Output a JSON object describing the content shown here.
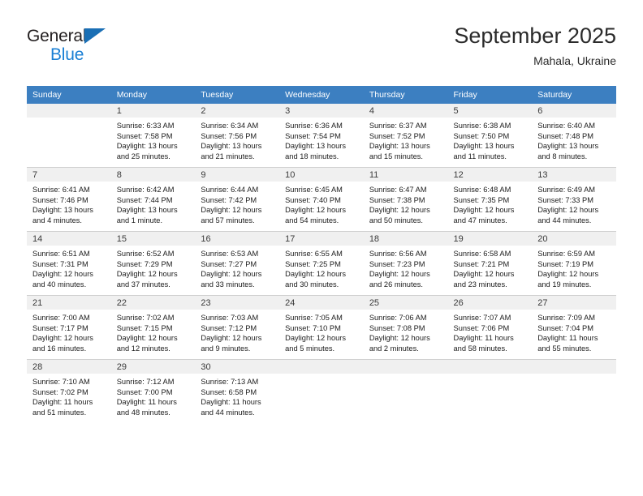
{
  "brand": {
    "line1": "General",
    "line2": "Blue",
    "triangle_color": "#1a6fb5",
    "blue_color": "#1a7fd4"
  },
  "header": {
    "title": "September 2025",
    "subtitle": "Mahala, Ukraine"
  },
  "theme": {
    "header_row_bg": "#3c7fc1",
    "daynum_bg": "#f0f0f0",
    "grid_line": "#cfcfcf"
  },
  "weekday_headers": [
    "Sunday",
    "Monday",
    "Tuesday",
    "Wednesday",
    "Thursday",
    "Friday",
    "Saturday"
  ],
  "weeks": [
    [
      {
        "day": "",
        "sunrise": "",
        "sunset": "",
        "daylight1": "",
        "daylight2": "",
        "empty": true
      },
      {
        "day": "1",
        "sunrise": "Sunrise: 6:33 AM",
        "sunset": "Sunset: 7:58 PM",
        "daylight1": "Daylight: 13 hours",
        "daylight2": "and 25 minutes.",
        "empty": false
      },
      {
        "day": "2",
        "sunrise": "Sunrise: 6:34 AM",
        "sunset": "Sunset: 7:56 PM",
        "daylight1": "Daylight: 13 hours",
        "daylight2": "and 21 minutes.",
        "empty": false
      },
      {
        "day": "3",
        "sunrise": "Sunrise: 6:36 AM",
        "sunset": "Sunset: 7:54 PM",
        "daylight1": "Daylight: 13 hours",
        "daylight2": "and 18 minutes.",
        "empty": false
      },
      {
        "day": "4",
        "sunrise": "Sunrise: 6:37 AM",
        "sunset": "Sunset: 7:52 PM",
        "daylight1": "Daylight: 13 hours",
        "daylight2": "and 15 minutes.",
        "empty": false
      },
      {
        "day": "5",
        "sunrise": "Sunrise: 6:38 AM",
        "sunset": "Sunset: 7:50 PM",
        "daylight1": "Daylight: 13 hours",
        "daylight2": "and 11 minutes.",
        "empty": false
      },
      {
        "day": "6",
        "sunrise": "Sunrise: 6:40 AM",
        "sunset": "Sunset: 7:48 PM",
        "daylight1": "Daylight: 13 hours",
        "daylight2": "and 8 minutes.",
        "empty": false
      }
    ],
    [
      {
        "day": "7",
        "sunrise": "Sunrise: 6:41 AM",
        "sunset": "Sunset: 7:46 PM",
        "daylight1": "Daylight: 13 hours",
        "daylight2": "and 4 minutes.",
        "empty": false
      },
      {
        "day": "8",
        "sunrise": "Sunrise: 6:42 AM",
        "sunset": "Sunset: 7:44 PM",
        "daylight1": "Daylight: 13 hours",
        "daylight2": "and 1 minute.",
        "empty": false
      },
      {
        "day": "9",
        "sunrise": "Sunrise: 6:44 AM",
        "sunset": "Sunset: 7:42 PM",
        "daylight1": "Daylight: 12 hours",
        "daylight2": "and 57 minutes.",
        "empty": false
      },
      {
        "day": "10",
        "sunrise": "Sunrise: 6:45 AM",
        "sunset": "Sunset: 7:40 PM",
        "daylight1": "Daylight: 12 hours",
        "daylight2": "and 54 minutes.",
        "empty": false
      },
      {
        "day": "11",
        "sunrise": "Sunrise: 6:47 AM",
        "sunset": "Sunset: 7:38 PM",
        "daylight1": "Daylight: 12 hours",
        "daylight2": "and 50 minutes.",
        "empty": false
      },
      {
        "day": "12",
        "sunrise": "Sunrise: 6:48 AM",
        "sunset": "Sunset: 7:35 PM",
        "daylight1": "Daylight: 12 hours",
        "daylight2": "and 47 minutes.",
        "empty": false
      },
      {
        "day": "13",
        "sunrise": "Sunrise: 6:49 AM",
        "sunset": "Sunset: 7:33 PM",
        "daylight1": "Daylight: 12 hours",
        "daylight2": "and 44 minutes.",
        "empty": false
      }
    ],
    [
      {
        "day": "14",
        "sunrise": "Sunrise: 6:51 AM",
        "sunset": "Sunset: 7:31 PM",
        "daylight1": "Daylight: 12 hours",
        "daylight2": "and 40 minutes.",
        "empty": false
      },
      {
        "day": "15",
        "sunrise": "Sunrise: 6:52 AM",
        "sunset": "Sunset: 7:29 PM",
        "daylight1": "Daylight: 12 hours",
        "daylight2": "and 37 minutes.",
        "empty": false
      },
      {
        "day": "16",
        "sunrise": "Sunrise: 6:53 AM",
        "sunset": "Sunset: 7:27 PM",
        "daylight1": "Daylight: 12 hours",
        "daylight2": "and 33 minutes.",
        "empty": false
      },
      {
        "day": "17",
        "sunrise": "Sunrise: 6:55 AM",
        "sunset": "Sunset: 7:25 PM",
        "daylight1": "Daylight: 12 hours",
        "daylight2": "and 30 minutes.",
        "empty": false
      },
      {
        "day": "18",
        "sunrise": "Sunrise: 6:56 AM",
        "sunset": "Sunset: 7:23 PM",
        "daylight1": "Daylight: 12 hours",
        "daylight2": "and 26 minutes.",
        "empty": false
      },
      {
        "day": "19",
        "sunrise": "Sunrise: 6:58 AM",
        "sunset": "Sunset: 7:21 PM",
        "daylight1": "Daylight: 12 hours",
        "daylight2": "and 23 minutes.",
        "empty": false
      },
      {
        "day": "20",
        "sunrise": "Sunrise: 6:59 AM",
        "sunset": "Sunset: 7:19 PM",
        "daylight1": "Daylight: 12 hours",
        "daylight2": "and 19 minutes.",
        "empty": false
      }
    ],
    [
      {
        "day": "21",
        "sunrise": "Sunrise: 7:00 AM",
        "sunset": "Sunset: 7:17 PM",
        "daylight1": "Daylight: 12 hours",
        "daylight2": "and 16 minutes.",
        "empty": false
      },
      {
        "day": "22",
        "sunrise": "Sunrise: 7:02 AM",
        "sunset": "Sunset: 7:15 PM",
        "daylight1": "Daylight: 12 hours",
        "daylight2": "and 12 minutes.",
        "empty": false
      },
      {
        "day": "23",
        "sunrise": "Sunrise: 7:03 AM",
        "sunset": "Sunset: 7:12 PM",
        "daylight1": "Daylight: 12 hours",
        "daylight2": "and 9 minutes.",
        "empty": false
      },
      {
        "day": "24",
        "sunrise": "Sunrise: 7:05 AM",
        "sunset": "Sunset: 7:10 PM",
        "daylight1": "Daylight: 12 hours",
        "daylight2": "and 5 minutes.",
        "empty": false
      },
      {
        "day": "25",
        "sunrise": "Sunrise: 7:06 AM",
        "sunset": "Sunset: 7:08 PM",
        "daylight1": "Daylight: 12 hours",
        "daylight2": "and 2 minutes.",
        "empty": false
      },
      {
        "day": "26",
        "sunrise": "Sunrise: 7:07 AM",
        "sunset": "Sunset: 7:06 PM",
        "daylight1": "Daylight: 11 hours",
        "daylight2": "and 58 minutes.",
        "empty": false
      },
      {
        "day": "27",
        "sunrise": "Sunrise: 7:09 AM",
        "sunset": "Sunset: 7:04 PM",
        "daylight1": "Daylight: 11 hours",
        "daylight2": "and 55 minutes.",
        "empty": false
      }
    ],
    [
      {
        "day": "28",
        "sunrise": "Sunrise: 7:10 AM",
        "sunset": "Sunset: 7:02 PM",
        "daylight1": "Daylight: 11 hours",
        "daylight2": "and 51 minutes.",
        "empty": false
      },
      {
        "day": "29",
        "sunrise": "Sunrise: 7:12 AM",
        "sunset": "Sunset: 7:00 PM",
        "daylight1": "Daylight: 11 hours",
        "daylight2": "and 48 minutes.",
        "empty": false
      },
      {
        "day": "30",
        "sunrise": "Sunrise: 7:13 AM",
        "sunset": "Sunset: 6:58 PM",
        "daylight1": "Daylight: 11 hours",
        "daylight2": "and 44 minutes.",
        "empty": false
      },
      {
        "day": "",
        "sunrise": "",
        "sunset": "",
        "daylight1": "",
        "daylight2": "",
        "empty": true
      },
      {
        "day": "",
        "sunrise": "",
        "sunset": "",
        "daylight1": "",
        "daylight2": "",
        "empty": true
      },
      {
        "day": "",
        "sunrise": "",
        "sunset": "",
        "daylight1": "",
        "daylight2": "",
        "empty": true
      },
      {
        "day": "",
        "sunrise": "",
        "sunset": "",
        "daylight1": "",
        "daylight2": "",
        "empty": true
      }
    ]
  ]
}
